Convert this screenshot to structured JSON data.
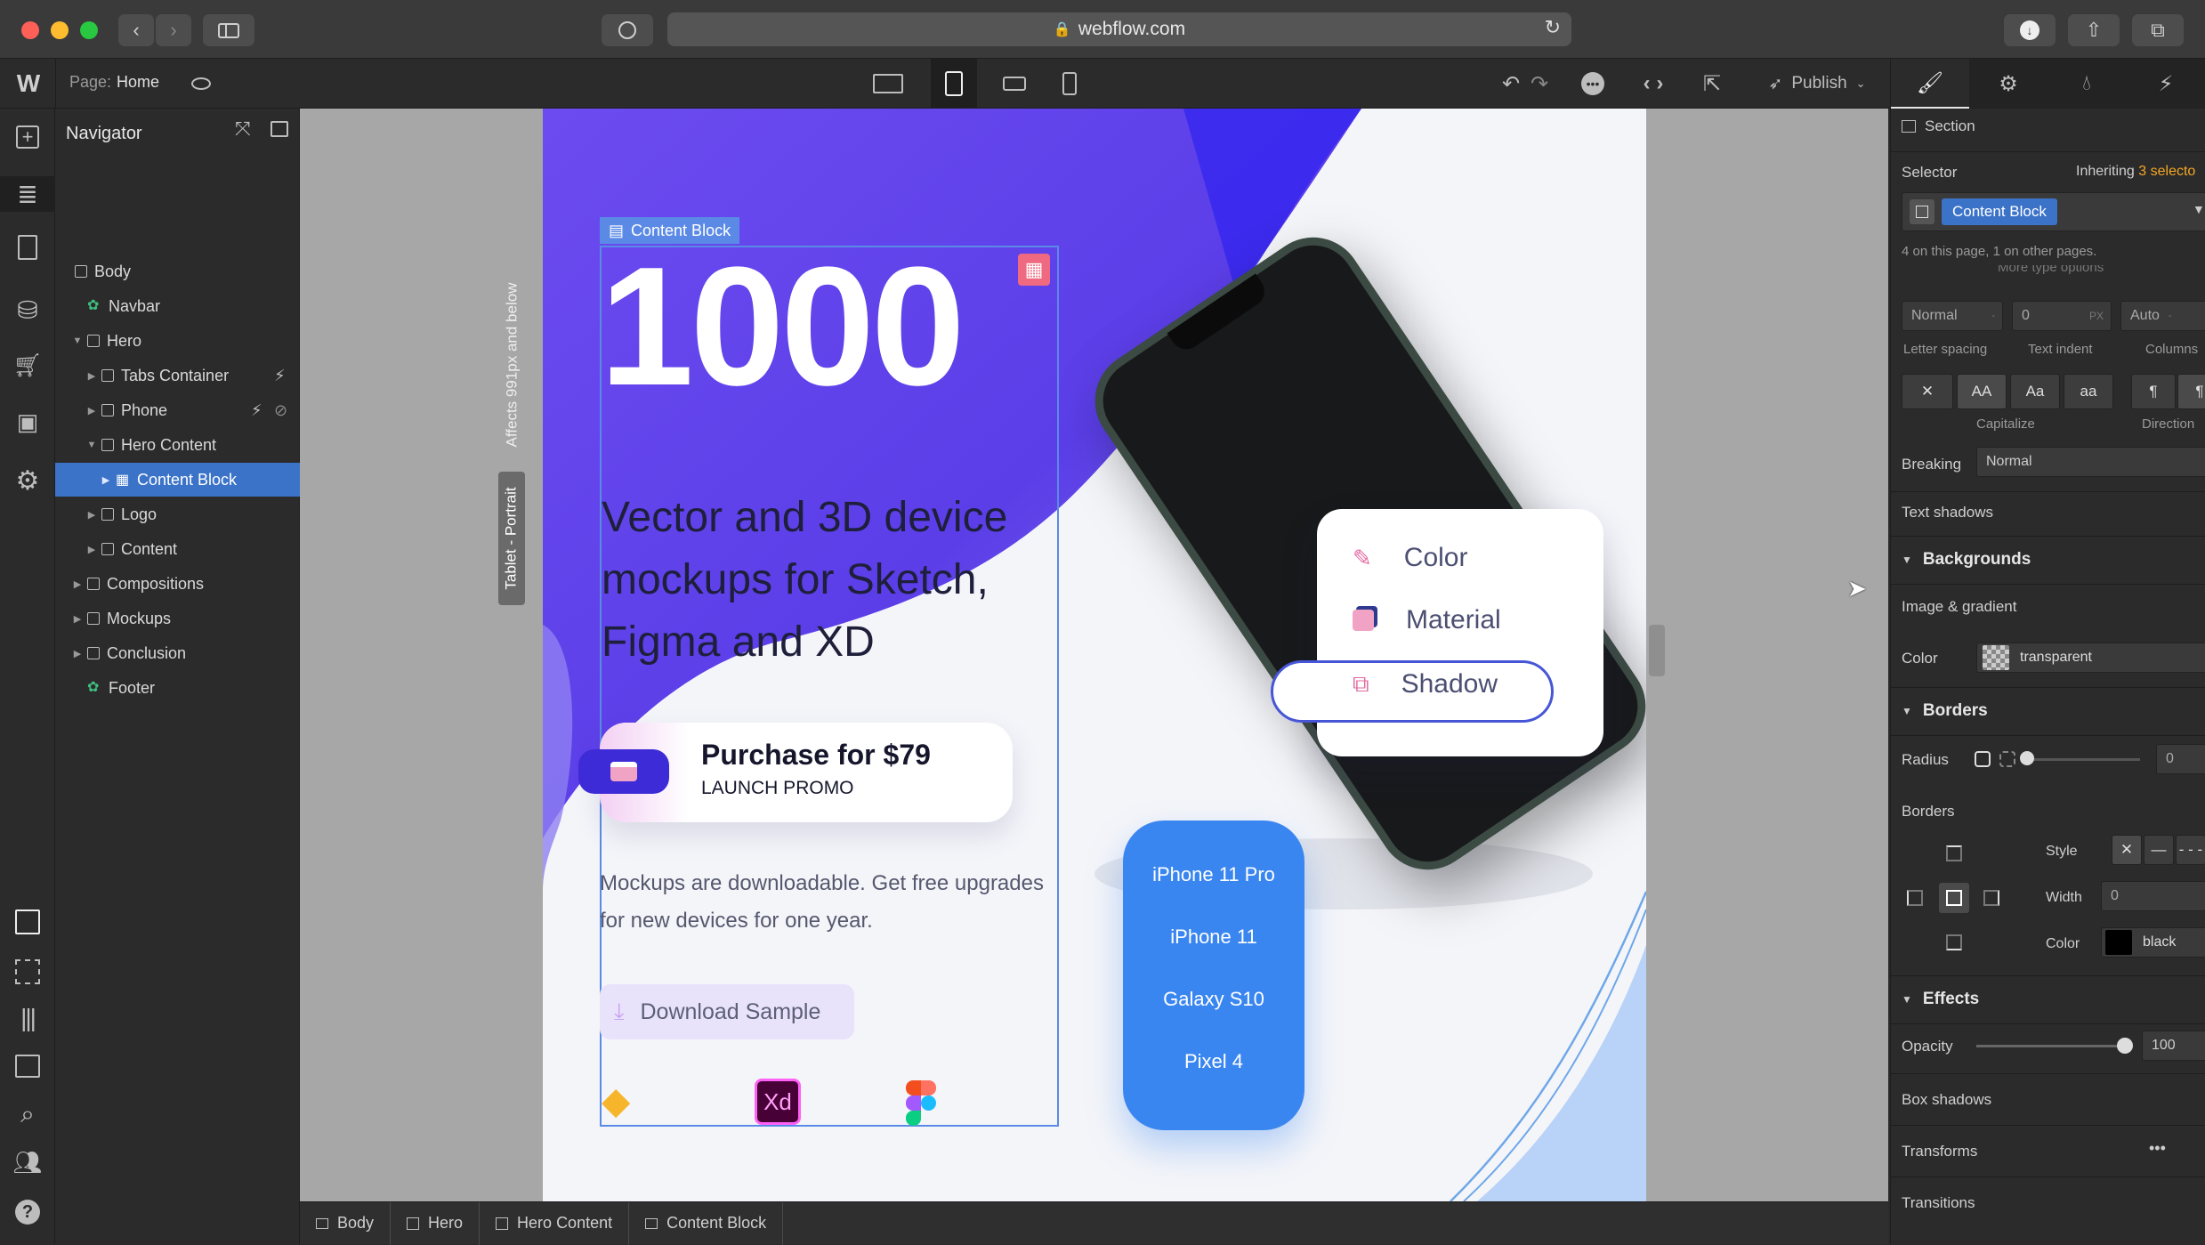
{
  "browser": {
    "url": "webflow.com",
    "lock_icon": "lock-icon"
  },
  "topbar": {
    "page_label": "Page:",
    "page_name": "Home",
    "publish_label": "Publish"
  },
  "navigator": {
    "title": "Navigator",
    "items": [
      {
        "label": "Body",
        "icon": "body-icon"
      },
      {
        "label": "Navbar",
        "icon": "symbol-icon"
      },
      {
        "label": "Hero",
        "icon": "section-icon"
      },
      {
        "label": "Tabs Container",
        "icon": "tabs-icon"
      },
      {
        "label": "Phone",
        "icon": "div-icon"
      },
      {
        "label": "Hero Content",
        "icon": "container-icon"
      },
      {
        "label": "Content Block",
        "icon": "grid-icon"
      },
      {
        "label": "Logo",
        "icon": "div-icon"
      },
      {
        "label": "Content",
        "icon": "container-icon"
      },
      {
        "label": "Compositions",
        "icon": "section-icon"
      },
      {
        "label": "Mockups",
        "icon": "section-icon"
      },
      {
        "label": "Conclusion",
        "icon": "section-icon"
      },
      {
        "label": "Footer",
        "icon": "symbol-icon"
      }
    ]
  },
  "canvas": {
    "breakpoint_note": "Affects 991px and below",
    "breakpoint_name": "Tablet - Portrait",
    "selected_label": "Content Block",
    "big_number": "1000",
    "headline": "Vector and 3D device mockups for Sketch, Figma and XD",
    "purchase_title": "Purchase for $79",
    "purchase_sub": "LAUNCH PROMO",
    "description": "Mockups are downloadable. Get free upgrades for new devices for one year.",
    "download_label": "Download Sample",
    "xd_label": "Xd",
    "options": [
      "Color",
      "Material",
      "Shadow"
    ],
    "devices": [
      "iPhone 11 Pro",
      "iPhone 11",
      "Galaxy S10",
      "Pixel 4"
    ]
  },
  "breadcrumbs": [
    "Body",
    "Hero",
    "Hero Content",
    "Content Block"
  ],
  "panel": {
    "element_type": "Section",
    "selector_label": "Selector",
    "inheriting_prefix": "Inheriting",
    "inheriting_count": "3 selecto",
    "selector_value": "Content Block",
    "selector_note": "4 on this page, 1 on other pages.",
    "more_type": "More type options",
    "letter_spacing_value": "Normal",
    "text_indent_value": "0",
    "text_indent_unit": "PX",
    "columns_value": "Auto",
    "letter_spacing_label": "Letter spacing",
    "text_indent_label": "Text indent",
    "columns_label": "Columns",
    "capitalize_options": [
      "AA",
      "Aa",
      "aa"
    ],
    "capitalize_label": "Capitalize",
    "direction_label": "Direction",
    "breaking_label": "Breaking",
    "breaking_value": "Normal",
    "text_shadows_label": "Text shadows",
    "backgrounds_title": "Backgrounds",
    "image_gradient_label": "Image & gradient",
    "color_label": "Color",
    "bg_color_value": "transparent",
    "borders_title": "Borders",
    "radius_label": "Radius",
    "radius_value": "0",
    "borders_label": "Borders",
    "style_label": "Style",
    "width_label": "Width",
    "width_value": "0",
    "border_color_label": "Color",
    "border_color_value": "black",
    "effects_title": "Effects",
    "opacity_label": "Opacity",
    "opacity_value": "100",
    "box_shadows_label": "Box shadows",
    "transforms_label": "Transforms",
    "transitions_label": "Transitions"
  },
  "colors": {
    "accent": "#3b73c9",
    "hero_purple": "#5b45e8",
    "device_blue": "#3a86f0",
    "warn_orange": "#f5a623"
  }
}
